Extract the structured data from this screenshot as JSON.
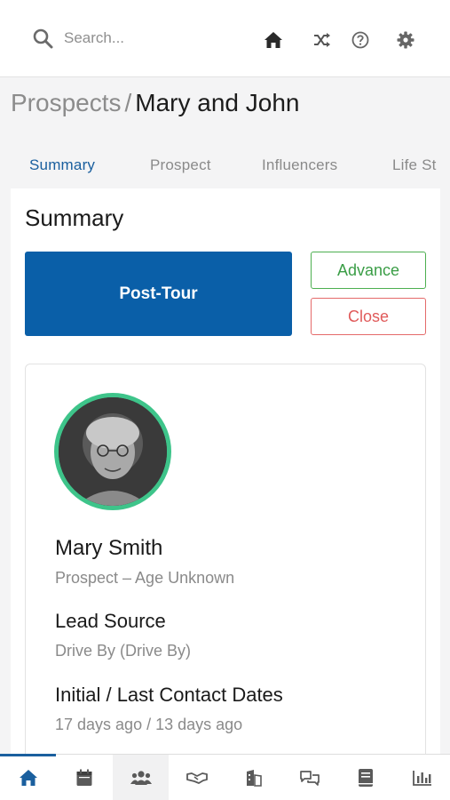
{
  "search": {
    "placeholder": "Search..."
  },
  "header_icons": [
    "home-icon",
    "shuffle-icon",
    "help-icon",
    "gear-icon"
  ],
  "breadcrumb": {
    "parent": "Prospects",
    "separator": "/",
    "current": "Mary and John"
  },
  "tabs": [
    {
      "label": "Summary",
      "active": true
    },
    {
      "label": "Prospect",
      "active": false
    },
    {
      "label": "Influencers",
      "active": false
    },
    {
      "label": "Life St",
      "active": false
    }
  ],
  "summary": {
    "title": "Summary",
    "stage_label": "Post-Tour",
    "advance_label": "Advance",
    "close_label": "Close"
  },
  "prospect": {
    "name": "Mary Smith",
    "subtitle": "Prospect – Age Unknown",
    "lead_source_label": "Lead Source",
    "lead_source_value": "Drive By (Drive By)",
    "contact_dates_label": "Initial / Last Contact Dates",
    "contact_dates_value": "17 days ago / 13 days ago"
  },
  "bottom_nav": [
    {
      "icon": "home-icon",
      "active": true
    },
    {
      "icon": "calendar-icon",
      "active": false
    },
    {
      "icon": "people-icon",
      "active": false
    },
    {
      "icon": "handshake-icon",
      "active": false
    },
    {
      "icon": "building-icon",
      "active": false
    },
    {
      "icon": "chat-icon",
      "active": false
    },
    {
      "icon": "book-icon",
      "active": false
    },
    {
      "icon": "chart-icon",
      "active": false
    }
  ],
  "colors": {
    "brand_blue": "#0a5fa8",
    "tab_active": "#1a5f9e",
    "advance_green": "#4caf50",
    "close_red": "#e46a6a",
    "avatar_ring": "#3ec48a"
  }
}
